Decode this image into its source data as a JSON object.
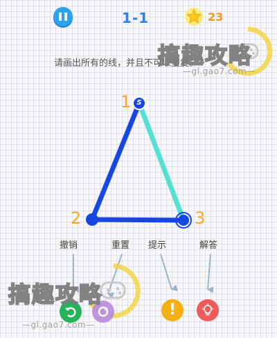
{
  "header": {
    "level": "1-1",
    "coins": "23"
  },
  "instruction": "请画出所有的线，并且不可以重复。",
  "nodes": [
    {
      "label": "1",
      "badge": "S"
    },
    {
      "label": "2"
    },
    {
      "label": "3"
    }
  ],
  "tools": [
    {
      "id": "undo",
      "label": "撤销",
      "color": "#27b35a",
      "icon": "undo-icon"
    },
    {
      "id": "reset",
      "label": "重置",
      "color": "#b98be0",
      "icon": "reset-icon"
    },
    {
      "id": "hint",
      "label": "提示",
      "color": "#f5b016",
      "icon": "exclamation-icon"
    },
    {
      "id": "solution",
      "label": "解答",
      "color": "#ef5a5a",
      "icon": "lightbulb-icon"
    }
  ],
  "watermark": {
    "brand": "搞趣攻略",
    "url": "—gl.gao7.com—"
  },
  "colors": {
    "drawn_line": "#1846e0",
    "hint_line": "#55e0d3",
    "accent": "#2aa3ef",
    "node_label": "#f4a92a"
  }
}
